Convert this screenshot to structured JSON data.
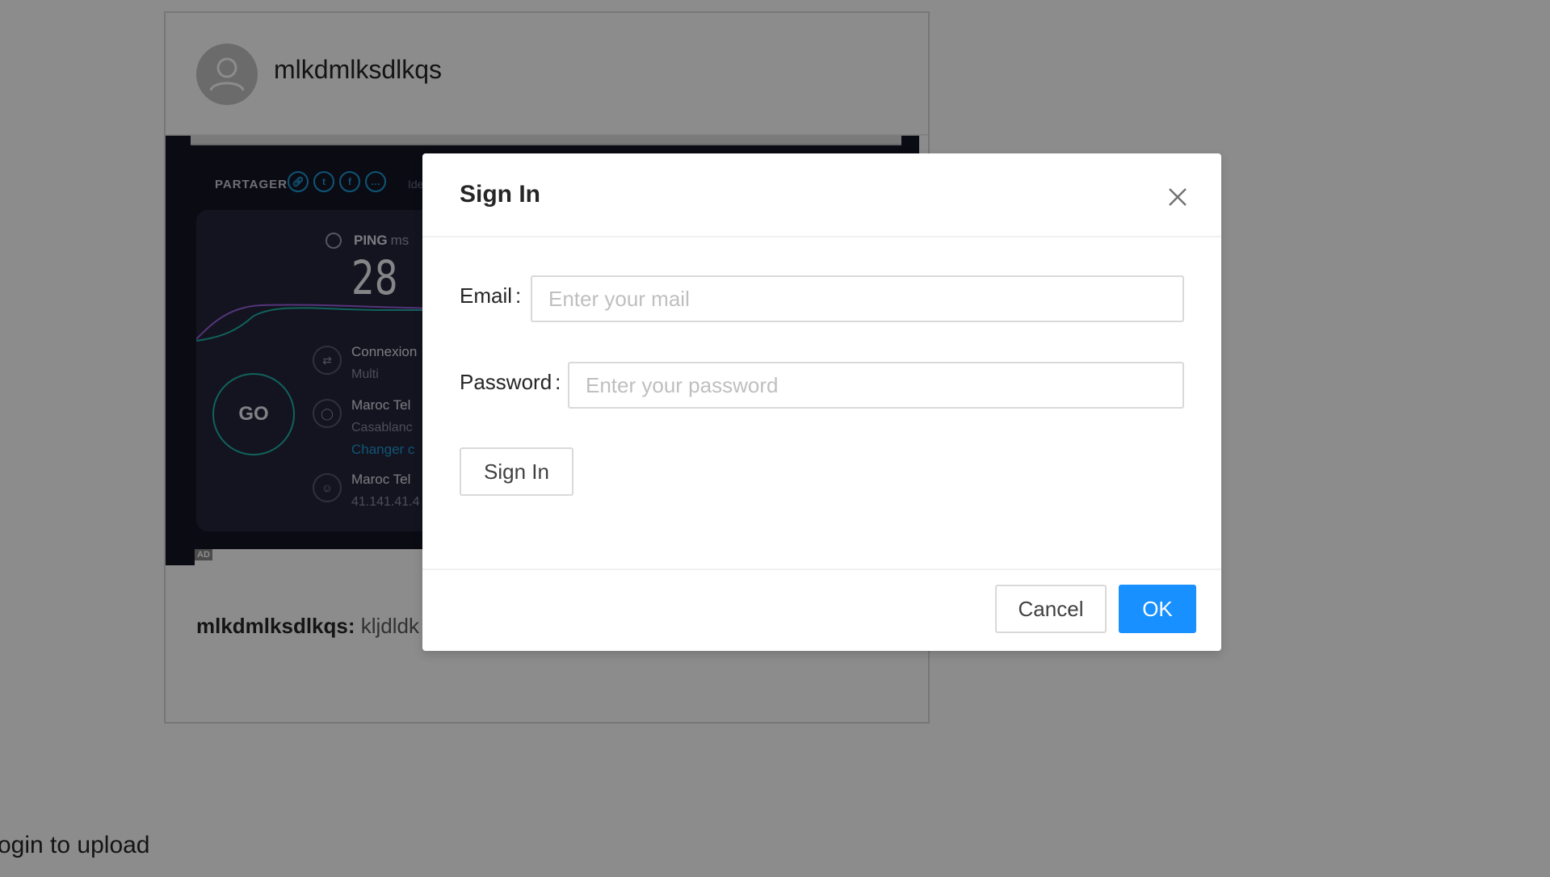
{
  "post": {
    "username": "mlkdmlksdlkqs",
    "image": {
      "share_label": "PARTAGER",
      "share_extra": "Ide",
      "ping_label": "PING",
      "ping_unit": "ms",
      "ping_value": "28",
      "go_label": "GO",
      "connection_title": "Connexion",
      "connection_sub": "Multi",
      "server_title": "Maroc Tel",
      "server_sub": "Casablanc",
      "server_link": "Changer c",
      "isp_title": "Maroc Tel",
      "isp_sub": "41.141.41.4",
      "ad_badge": "AD",
      "colors": {
        "background": "#141526",
        "panel": "#23263a",
        "accent": "#1d9bd8",
        "go_ring": "#1fb3a9",
        "graph_purple": "#9b5fe0",
        "graph_teal": "#1fb3a9"
      }
    },
    "caption_user": "mlkdmlksdlkqs:",
    "caption_text": "kljdldk"
  },
  "upload_note": "ogin to upload",
  "modal": {
    "title": "Sign In",
    "email_label": "Email",
    "email_placeholder": "Enter your mail",
    "email_value": "",
    "password_label": "Password",
    "password_placeholder": "Enter your password",
    "password_value": "",
    "label_colon": ":",
    "signin_button": "Sign In",
    "cancel_button": "Cancel",
    "ok_button": "OK",
    "colors": {
      "primary": "#1890ff",
      "mask": "rgba(0,0,0,0.45)"
    }
  }
}
